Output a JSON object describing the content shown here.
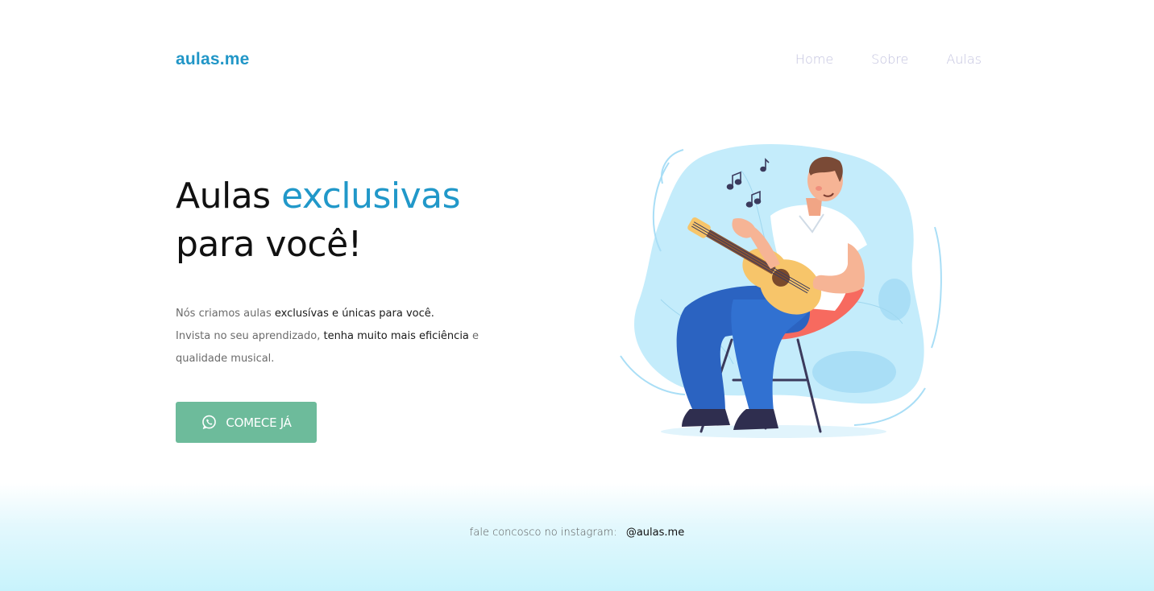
{
  "header": {
    "logo": "aulas.me",
    "nav": {
      "home": "Home",
      "sobre": "Sobre",
      "aulas": "Aulas"
    }
  },
  "hero": {
    "title_part1": "Aulas ",
    "title_accent": "exclusivas",
    "title_part2": "para você!",
    "desc_line1_plain": "Nós criamos aulas ",
    "desc_line1_bold": "exclusívas e únicas para você.",
    "desc_line2_plain": "Invista no seu aprendizado, ",
    "desc_line2_bold": "tenha muito mais eficiência",
    "desc_line2_end": " e",
    "desc_line3": "qualidade musical.",
    "cta_label": "COMECE JÁ",
    "cta_icon": "whatsapp-icon"
  },
  "illustration": {
    "subject": "man-playing-guitar-illustration"
  },
  "footer": {
    "text": "fale concosco no instagram:",
    "handle": "@aulas.me"
  },
  "colors": {
    "accent": "#2198c9",
    "cta_bg": "#6dbb9b",
    "nav_text": "#c3c3df",
    "footer_gradient_end": "#c8f3fc",
    "blob": "#c4ecfb"
  }
}
